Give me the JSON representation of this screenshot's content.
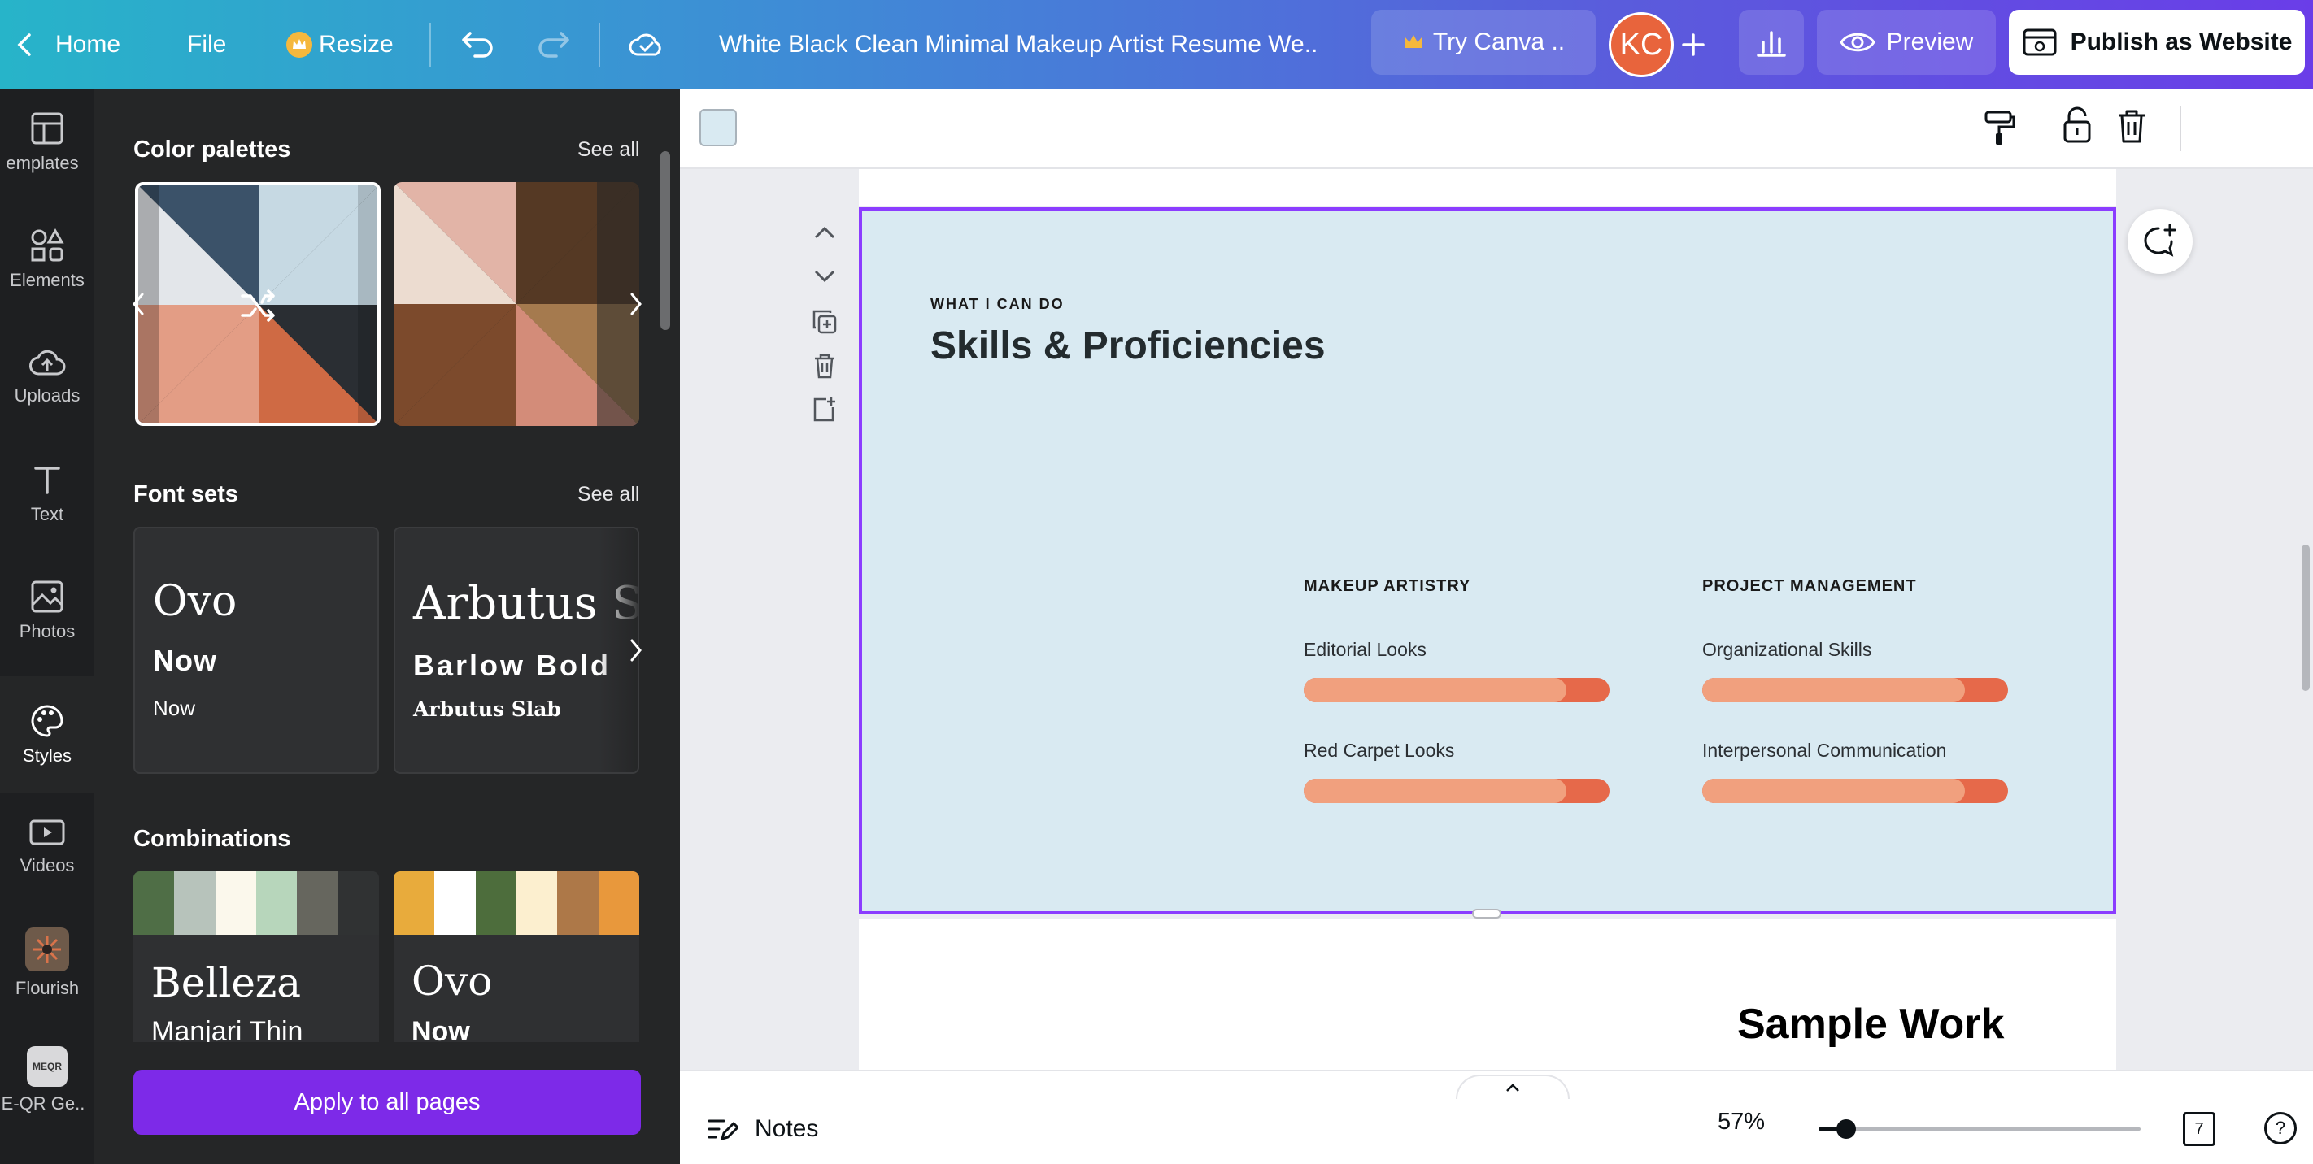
{
  "topbar": {
    "home_label": "Home",
    "file_label": "File",
    "resize_label": "Resize",
    "doc_title": "White Black Clean Minimal Makeup Artist Resume We..",
    "try_canva_label": "Try Canva ..",
    "avatar_initials": "KC",
    "preview_label": "Preview",
    "publish_label": "Publish as Website"
  },
  "rail": {
    "items": [
      {
        "label": "emplates",
        "icon": "templates-icon"
      },
      {
        "label": "Elements",
        "icon": "elements-icon"
      },
      {
        "label": "Uploads",
        "icon": "uploads-icon"
      },
      {
        "label": "Text",
        "icon": "text-icon"
      },
      {
        "label": "Photos",
        "icon": "photos-icon"
      },
      {
        "label": "Styles",
        "icon": "styles-icon"
      },
      {
        "label": "Videos",
        "icon": "videos-icon"
      },
      {
        "label": "Flourish",
        "icon": "flourish-app-icon"
      },
      {
        "label": "E-QR Ge..",
        "icon": "qr-app-icon"
      }
    ],
    "qr_icon_text": "MEQR"
  },
  "panel": {
    "color_palettes_title": "Color palettes",
    "font_sets_title": "Font sets",
    "combinations_title": "Combinations",
    "see_all": "See all",
    "font_sets": [
      {
        "heading": "Ovo",
        "subheading": "Now",
        "body": "Now"
      },
      {
        "heading": "Arbutus Slab",
        "subheading": "Barlow Bold",
        "body": "Arbutus Slab"
      }
    ],
    "combinations": [
      {
        "heading": "Belleza",
        "subheading": "Manjari Thin",
        "swatches": [
          "#4f6e46",
          "#b7c3bb",
          "#fbf8ec",
          "#b7d6bb",
          "#66665e",
          "#303233"
        ]
      },
      {
        "heading": "Ovo",
        "subheading": "Now",
        "swatches": [
          "#e8ab3c",
          "#ffffff",
          "#4d6d3c",
          "#fcefcf",
          "#ad7848",
          "#e8983c"
        ]
      }
    ],
    "apply_label": "Apply to all pages"
  },
  "colors": {
    "accent": "#8b3dff",
    "apply_button": "#7d2ae8",
    "page_bg": "#d9eaf2",
    "bar_track": "#e6694a",
    "bar_fill": "#f1a07e",
    "context_swatch": "#d9eaf2"
  },
  "page": {
    "eyebrow": "WHAT I CAN DO",
    "headline": "Skills & Proficiencies",
    "columns": [
      {
        "heading": "MAKEUP ARTISTRY",
        "skills": [
          {
            "label": "Editorial Looks",
            "level": 0.86
          },
          {
            "label": "Red Carpet Looks",
            "level": 0.86
          }
        ]
      },
      {
        "heading": "PROJECT MANAGEMENT",
        "skills": [
          {
            "label": "Organizational Skills",
            "level": 0.86
          },
          {
            "label": "Interpersonal Communication",
            "level": 0.86
          }
        ]
      }
    ],
    "next_page_heading": "Sample Work"
  },
  "bottombar": {
    "notes_label": "Notes",
    "zoom_label": "57%",
    "zoom_level": 0.57,
    "page_count": "7",
    "help_label": "?"
  }
}
